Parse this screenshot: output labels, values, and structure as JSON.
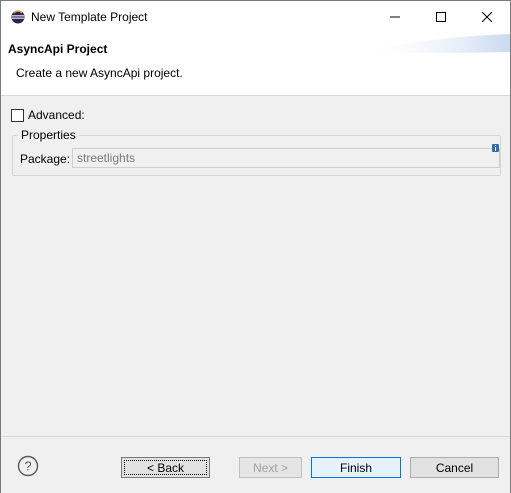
{
  "window": {
    "title": "New Template Project"
  },
  "header": {
    "title": "AsyncApi Project",
    "description": "Create a new AsyncApi project."
  },
  "form": {
    "advanced_label": "Advanced:",
    "advanced_checked": false,
    "properties_legend": "Properties",
    "package_label": "Package:",
    "package_value": "streetlights"
  },
  "footer": {
    "back_label": "< Back",
    "next_label": "Next >",
    "finish_label": "Finish",
    "cancel_label": "Cancel"
  },
  "icons": {
    "app": "eclipse-icon",
    "minimize": "minimize-icon",
    "maximize": "maximize-icon",
    "close": "close-icon",
    "info": "info-icon",
    "help": "help-icon"
  },
  "colors": {
    "window_bg": "#f0f0f0",
    "accent": "#0078d7",
    "disabled_text": "#a0a0a0"
  }
}
